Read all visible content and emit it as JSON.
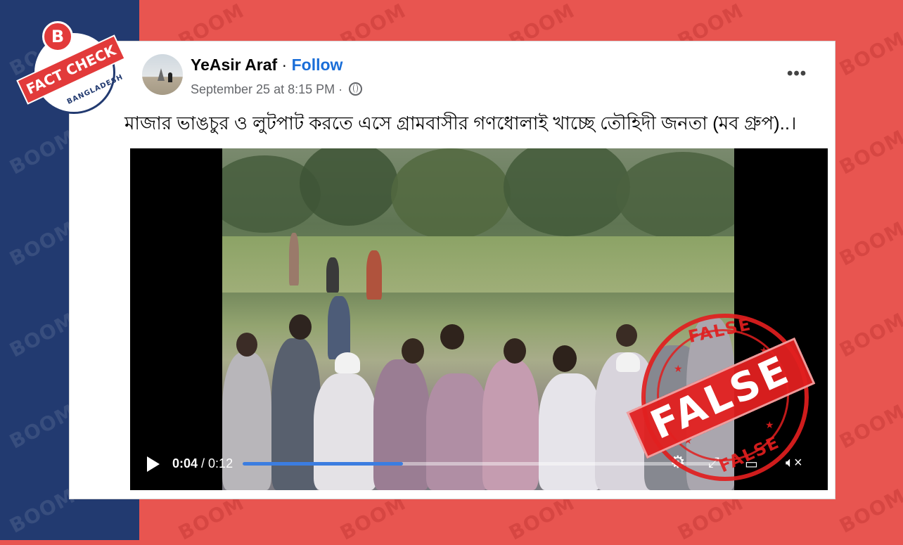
{
  "post": {
    "author": "YeAsir Araf",
    "separator": " · ",
    "follow_label": "Follow",
    "timestamp": "September 25 at 8:15 PM",
    "meta_separator": " · ",
    "more_label": "•••",
    "text": "মাজার ভাঙচুর ও লুটপাট করতে এসে গ্রামবাসীর গণধোলাই খাচ্ছে তৌহিদী জনতা (মব গ্রুপ)..।"
  },
  "video": {
    "current_time": "0:04",
    "time_separator": " / ",
    "duration": "0:12",
    "progress_fraction": 0.33
  },
  "badge": {
    "logo_letter": "B",
    "label": "FACT CHECK",
    "country": "BANGLADESH"
  },
  "stamp": {
    "verdict": "FALSE",
    "arc_top": "FALSE",
    "arc_bottom": "FALSE"
  },
  "watermark": "BOOM",
  "colors": {
    "background_red": "#e85550",
    "left_band_navy": "#223a70",
    "follow_blue": "#1a6ed8",
    "progress_blue": "#3b7de0",
    "stamp_red": "#e22020"
  }
}
